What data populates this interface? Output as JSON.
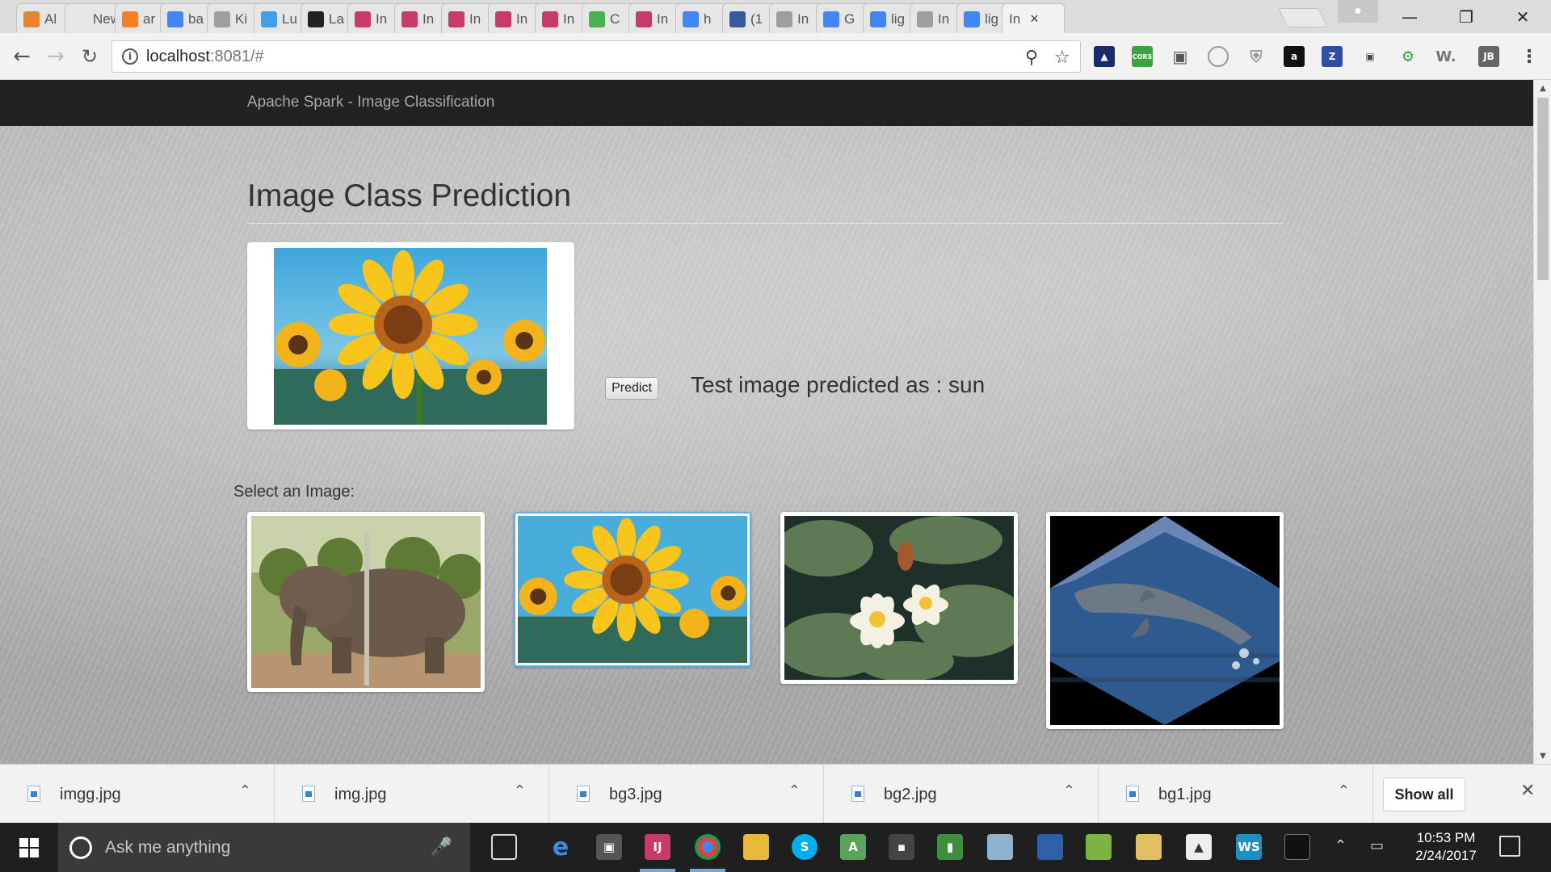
{
  "browser": {
    "tabs": [
      {
        "label": "Al",
        "icon": "aws-icon",
        "color": "#e8852c"
      },
      {
        "label": "New T",
        "icon": "blank-icon",
        "color": "#e6e6e6"
      },
      {
        "label": "ar",
        "icon": "stackoverflow-icon",
        "color": "#f48024"
      },
      {
        "label": "ba",
        "icon": "google-icon",
        "color": "#4285f4"
      },
      {
        "label": "Ki",
        "icon": "page-icon",
        "color": "#9e9e9e"
      },
      {
        "label": "Lu",
        "icon": "globe-icon",
        "color": "#3fa0e8"
      },
      {
        "label": "La",
        "icon": "github-icon",
        "color": "#222222"
      },
      {
        "label": "In",
        "icon": "intellij-icon",
        "color": "#c83a6a"
      },
      {
        "label": "In",
        "icon": "intellij-icon",
        "color": "#c83a6a"
      },
      {
        "label": "In",
        "icon": "intellij-icon",
        "color": "#c83a6a"
      },
      {
        "label": "In",
        "icon": "intellij-icon",
        "color": "#c83a6a"
      },
      {
        "label": "In",
        "icon": "intellij-icon",
        "color": "#c83a6a"
      },
      {
        "label": "C",
        "icon": "w3-icon",
        "color": "#4caf50"
      },
      {
        "label": "In",
        "icon": "intellij-icon",
        "color": "#c83a6a"
      },
      {
        "label": "h",
        "icon": "google-icon",
        "color": "#4285f4"
      },
      {
        "label": "(1",
        "icon": "facebook-icon",
        "color": "#3b5998"
      },
      {
        "label": "In",
        "icon": "page-icon",
        "color": "#9e9e9e"
      },
      {
        "label": "G",
        "icon": "google-icon",
        "color": "#4285f4"
      },
      {
        "label": "lig",
        "icon": "google-icon",
        "color": "#4285f4"
      },
      {
        "label": "In",
        "icon": "page-icon",
        "color": "#9e9e9e"
      },
      {
        "label": "lig",
        "icon": "google-icon",
        "color": "#4285f4"
      },
      {
        "label": "In",
        "icon": "",
        "color": "#f2f2f2",
        "active": true
      }
    ],
    "url_host": "localhost",
    "url_rest": ":8081/#"
  },
  "page": {
    "brand": "Apache Spark - Image Classification",
    "title": "Image Class Prediction",
    "predict_label": "Predict",
    "result_text": "Test image predicted as : sun",
    "select_label": "Select an Image:",
    "thumbnails": [
      {
        "name": "elephant",
        "selected": false
      },
      {
        "name": "sunflower",
        "selected": true
      },
      {
        "name": "water-lily",
        "selected": false
      },
      {
        "name": "dolphin",
        "selected": false
      }
    ]
  },
  "downloads": {
    "items": [
      "imgg.jpg",
      "img.jpg",
      "bg3.jpg",
      "bg2.jpg",
      "bg1.jpg"
    ],
    "show_all": "Show all"
  },
  "taskbar": {
    "search_placeholder": "Ask me anything",
    "time": "10:53 PM",
    "date": "2/24/2017"
  }
}
